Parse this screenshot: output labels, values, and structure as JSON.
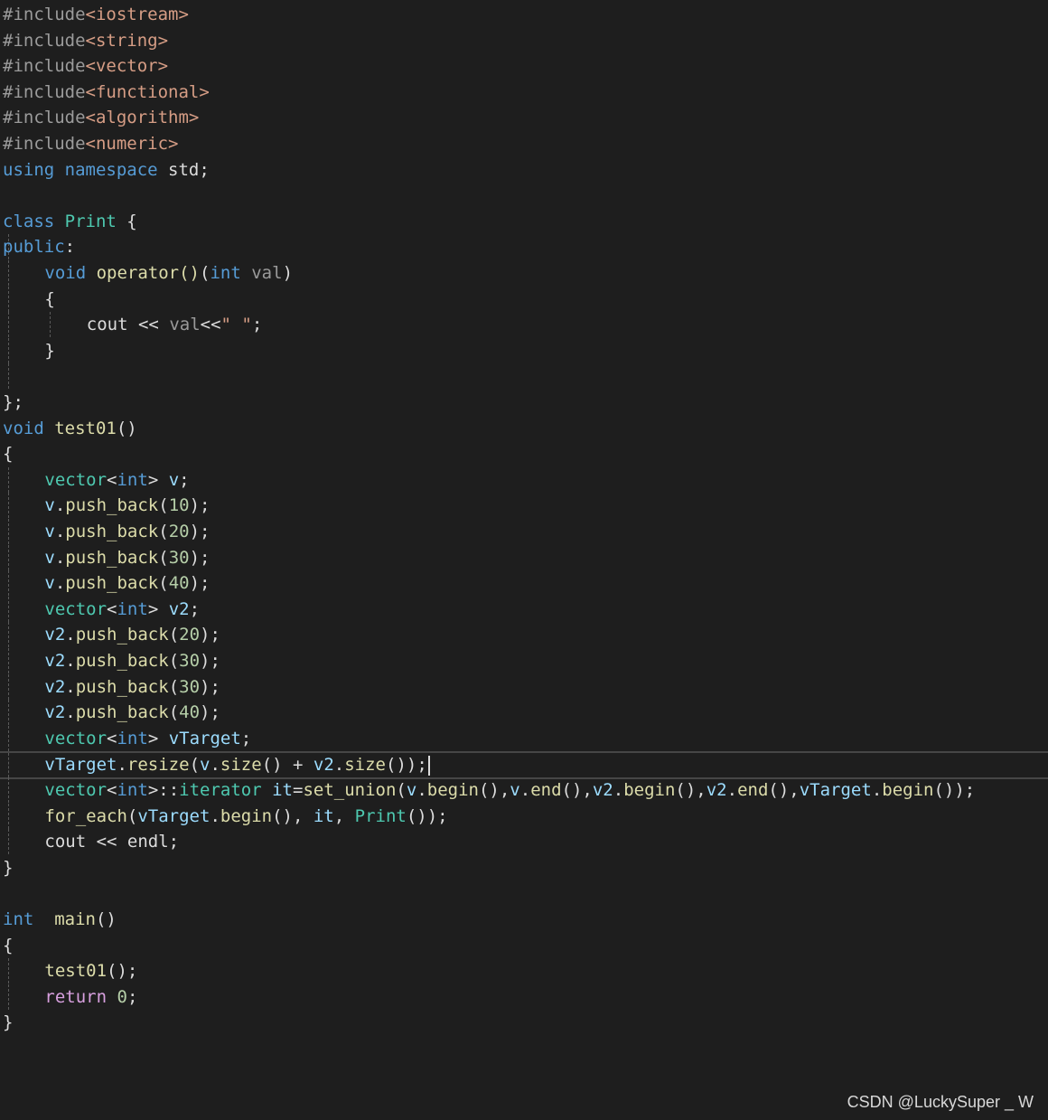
{
  "editor": {
    "lines": [
      {
        "tokens": [
          {
            "c": "pre",
            "t": "#include"
          },
          {
            "c": "inc",
            "t": "<iostream>"
          }
        ]
      },
      {
        "tokens": [
          {
            "c": "pre",
            "t": "#include"
          },
          {
            "c": "inc",
            "t": "<string>"
          }
        ]
      },
      {
        "tokens": [
          {
            "c": "pre",
            "t": "#include"
          },
          {
            "c": "inc",
            "t": "<vector>"
          }
        ]
      },
      {
        "tokens": [
          {
            "c": "pre",
            "t": "#include"
          },
          {
            "c": "inc",
            "t": "<functional>"
          }
        ]
      },
      {
        "tokens": [
          {
            "c": "pre",
            "t": "#include"
          },
          {
            "c": "inc",
            "t": "<algorithm>"
          }
        ]
      },
      {
        "tokens": [
          {
            "c": "pre",
            "t": "#include"
          },
          {
            "c": "inc",
            "t": "<numeric>"
          }
        ]
      },
      {
        "tokens": [
          {
            "c": "kw",
            "t": "using"
          },
          {
            "c": "pl",
            "t": " "
          },
          {
            "c": "kw",
            "t": "namespace"
          },
          {
            "c": "pl",
            "t": " std;"
          }
        ]
      },
      {
        "tokens": []
      },
      {
        "tokens": [
          {
            "c": "kw",
            "t": "class"
          },
          {
            "c": "pl",
            "t": " "
          },
          {
            "c": "ty",
            "t": "Print"
          },
          {
            "c": "pl",
            "t": " {"
          }
        ]
      },
      {
        "tokens": [
          {
            "c": "kw",
            "t": "public"
          },
          {
            "c": "pl",
            "t": ":"
          }
        ],
        "guides": [
          0
        ]
      },
      {
        "tokens": [
          {
            "c": "kw",
            "t": "void"
          },
          {
            "c": "pl",
            "t": " "
          },
          {
            "c": "fn",
            "t": "operator()"
          },
          {
            "c": "pl",
            "t": "("
          },
          {
            "c": "kw",
            "t": "int"
          },
          {
            "c": "pl",
            "t": " "
          },
          {
            "c": "par",
            "t": "val"
          },
          {
            "c": "pl",
            "t": ")"
          }
        ],
        "indent": 4,
        "guides": [
          0
        ]
      },
      {
        "tokens": [
          {
            "c": "pl",
            "t": "{"
          }
        ],
        "indent": 4,
        "guides": [
          0
        ]
      },
      {
        "tokens": [
          {
            "c": "pl",
            "t": "cout << "
          },
          {
            "c": "par",
            "t": "val"
          },
          {
            "c": "pl",
            "t": "<<"
          },
          {
            "c": "str",
            "t": "\" \""
          },
          {
            "c": "pl",
            "t": ";"
          }
        ],
        "indent": 8,
        "guides": [
          0,
          4
        ]
      },
      {
        "tokens": [
          {
            "c": "pl",
            "t": "}"
          }
        ],
        "indent": 4,
        "guides": [
          0
        ]
      },
      {
        "tokens": [],
        "guides": [
          0
        ]
      },
      {
        "tokens": [
          {
            "c": "pl",
            "t": "};"
          }
        ]
      },
      {
        "tokens": [
          {
            "c": "kw",
            "t": "void"
          },
          {
            "c": "pl",
            "t": " "
          },
          {
            "c": "fn",
            "t": "test01"
          },
          {
            "c": "pl",
            "t": "()"
          }
        ]
      },
      {
        "tokens": [
          {
            "c": "pl",
            "t": "{"
          }
        ]
      },
      {
        "tokens": [
          {
            "c": "ty",
            "t": "vector"
          },
          {
            "c": "pl",
            "t": "<"
          },
          {
            "c": "kw",
            "t": "int"
          },
          {
            "c": "pl",
            "t": "> "
          },
          {
            "c": "var",
            "t": "v"
          },
          {
            "c": "pl",
            "t": ";"
          }
        ],
        "indent": 4,
        "guides": [
          0
        ]
      },
      {
        "tokens": [
          {
            "c": "var",
            "t": "v"
          },
          {
            "c": "pl",
            "t": "."
          },
          {
            "c": "fn",
            "t": "push_back"
          },
          {
            "c": "pl",
            "t": "("
          },
          {
            "c": "num",
            "t": "10"
          },
          {
            "c": "pl",
            "t": ");"
          }
        ],
        "indent": 4,
        "guides": [
          0
        ]
      },
      {
        "tokens": [
          {
            "c": "var",
            "t": "v"
          },
          {
            "c": "pl",
            "t": "."
          },
          {
            "c": "fn",
            "t": "push_back"
          },
          {
            "c": "pl",
            "t": "("
          },
          {
            "c": "num",
            "t": "20"
          },
          {
            "c": "pl",
            "t": ");"
          }
        ],
        "indent": 4,
        "guides": [
          0
        ]
      },
      {
        "tokens": [
          {
            "c": "var",
            "t": "v"
          },
          {
            "c": "pl",
            "t": "."
          },
          {
            "c": "fn",
            "t": "push_back"
          },
          {
            "c": "pl",
            "t": "("
          },
          {
            "c": "num",
            "t": "30"
          },
          {
            "c": "pl",
            "t": ");"
          }
        ],
        "indent": 4,
        "guides": [
          0
        ]
      },
      {
        "tokens": [
          {
            "c": "var",
            "t": "v"
          },
          {
            "c": "pl",
            "t": "."
          },
          {
            "c": "fn",
            "t": "push_back"
          },
          {
            "c": "pl",
            "t": "("
          },
          {
            "c": "num",
            "t": "40"
          },
          {
            "c": "pl",
            "t": ");"
          }
        ],
        "indent": 4,
        "guides": [
          0
        ]
      },
      {
        "tokens": [
          {
            "c": "ty",
            "t": "vector"
          },
          {
            "c": "pl",
            "t": "<"
          },
          {
            "c": "kw",
            "t": "int"
          },
          {
            "c": "pl",
            "t": "> "
          },
          {
            "c": "var",
            "t": "v2"
          },
          {
            "c": "pl",
            "t": ";"
          }
        ],
        "indent": 4,
        "guides": [
          0
        ]
      },
      {
        "tokens": [
          {
            "c": "var",
            "t": "v2"
          },
          {
            "c": "pl",
            "t": "."
          },
          {
            "c": "fn",
            "t": "push_back"
          },
          {
            "c": "pl",
            "t": "("
          },
          {
            "c": "num",
            "t": "20"
          },
          {
            "c": "pl",
            "t": ");"
          }
        ],
        "indent": 4,
        "guides": [
          0
        ]
      },
      {
        "tokens": [
          {
            "c": "var",
            "t": "v2"
          },
          {
            "c": "pl",
            "t": "."
          },
          {
            "c": "fn",
            "t": "push_back"
          },
          {
            "c": "pl",
            "t": "("
          },
          {
            "c": "num",
            "t": "30"
          },
          {
            "c": "pl",
            "t": ");"
          }
        ],
        "indent": 4,
        "guides": [
          0
        ]
      },
      {
        "tokens": [
          {
            "c": "var",
            "t": "v2"
          },
          {
            "c": "pl",
            "t": "."
          },
          {
            "c": "fn",
            "t": "push_back"
          },
          {
            "c": "pl",
            "t": "("
          },
          {
            "c": "num",
            "t": "30"
          },
          {
            "c": "pl",
            "t": ");"
          }
        ],
        "indent": 4,
        "guides": [
          0
        ]
      },
      {
        "tokens": [
          {
            "c": "var",
            "t": "v2"
          },
          {
            "c": "pl",
            "t": "."
          },
          {
            "c": "fn",
            "t": "push_back"
          },
          {
            "c": "pl",
            "t": "("
          },
          {
            "c": "num",
            "t": "40"
          },
          {
            "c": "pl",
            "t": ");"
          }
        ],
        "indent": 4,
        "guides": [
          0
        ]
      },
      {
        "tokens": [
          {
            "c": "ty",
            "t": "vector"
          },
          {
            "c": "pl",
            "t": "<"
          },
          {
            "c": "kw",
            "t": "int"
          },
          {
            "c": "pl",
            "t": "> "
          },
          {
            "c": "var",
            "t": "vTarget"
          },
          {
            "c": "pl",
            "t": ";"
          }
        ],
        "indent": 4,
        "guides": [
          0
        ]
      },
      {
        "tokens": [
          {
            "c": "var",
            "t": "vTarget"
          },
          {
            "c": "pl",
            "t": "."
          },
          {
            "c": "fn",
            "t": "resize"
          },
          {
            "c": "pl",
            "t": "("
          },
          {
            "c": "var",
            "t": "v"
          },
          {
            "c": "pl",
            "t": "."
          },
          {
            "c": "fn",
            "t": "size"
          },
          {
            "c": "pl",
            "t": "() + "
          },
          {
            "c": "var",
            "t": "v2"
          },
          {
            "c": "pl",
            "t": "."
          },
          {
            "c": "fn",
            "t": "size"
          },
          {
            "c": "pl",
            "t": "());"
          }
        ],
        "indent": 4,
        "guides": [
          0
        ],
        "current": true
      },
      {
        "tokens": [
          {
            "c": "ty",
            "t": "vector"
          },
          {
            "c": "pl",
            "t": "<"
          },
          {
            "c": "kw",
            "t": "int"
          },
          {
            "c": "pl",
            "t": ">::"
          },
          {
            "c": "ty",
            "t": "iterator"
          },
          {
            "c": "pl",
            "t": " "
          },
          {
            "c": "var",
            "t": "it"
          },
          {
            "c": "pl",
            "t": "="
          },
          {
            "c": "fn",
            "t": "set_union"
          },
          {
            "c": "pl",
            "t": "("
          },
          {
            "c": "var",
            "t": "v"
          },
          {
            "c": "pl",
            "t": "."
          },
          {
            "c": "fn",
            "t": "begin"
          },
          {
            "c": "pl",
            "t": "(),"
          },
          {
            "c": "var",
            "t": "v"
          },
          {
            "c": "pl",
            "t": "."
          },
          {
            "c": "fn",
            "t": "end"
          },
          {
            "c": "pl",
            "t": "(),"
          },
          {
            "c": "var",
            "t": "v2"
          },
          {
            "c": "pl",
            "t": "."
          },
          {
            "c": "fn",
            "t": "begin"
          },
          {
            "c": "pl",
            "t": "(),"
          },
          {
            "c": "var",
            "t": "v2"
          },
          {
            "c": "pl",
            "t": "."
          },
          {
            "c": "fn",
            "t": "end"
          },
          {
            "c": "pl",
            "t": "(),"
          },
          {
            "c": "var",
            "t": "vTarget"
          },
          {
            "c": "pl",
            "t": "."
          },
          {
            "c": "fn",
            "t": "begin"
          },
          {
            "c": "pl",
            "t": "());"
          }
        ],
        "indent": 4,
        "guides": [
          0
        ]
      },
      {
        "tokens": [
          {
            "c": "fn",
            "t": "for_each"
          },
          {
            "c": "pl",
            "t": "("
          },
          {
            "c": "var",
            "t": "vTarget"
          },
          {
            "c": "pl",
            "t": "."
          },
          {
            "c": "fn",
            "t": "begin"
          },
          {
            "c": "pl",
            "t": "(), "
          },
          {
            "c": "var",
            "t": "it"
          },
          {
            "c": "pl",
            "t": ", "
          },
          {
            "c": "ty",
            "t": "Print"
          },
          {
            "c": "pl",
            "t": "());"
          }
        ],
        "indent": 4,
        "guides": [
          0
        ]
      },
      {
        "tokens": [
          {
            "c": "pl",
            "t": "cout << endl;"
          }
        ],
        "indent": 4,
        "guides": [
          0
        ]
      },
      {
        "tokens": [
          {
            "c": "pl",
            "t": "}"
          }
        ]
      },
      {
        "tokens": []
      },
      {
        "tokens": [
          {
            "c": "kw",
            "t": "int"
          },
          {
            "c": "pl",
            "t": "  "
          },
          {
            "c": "fn",
            "t": "main"
          },
          {
            "c": "pl",
            "t": "()"
          }
        ]
      },
      {
        "tokens": [
          {
            "c": "pl",
            "t": "{"
          }
        ]
      },
      {
        "tokens": [
          {
            "c": "fn",
            "t": "test01"
          },
          {
            "c": "pl",
            "t": "();"
          }
        ],
        "indent": 4,
        "guides": [
          0
        ]
      },
      {
        "tokens": [
          {
            "c": "ctl",
            "t": "return"
          },
          {
            "c": "pl",
            "t": " "
          },
          {
            "c": "num",
            "t": "0"
          },
          {
            "c": "pl",
            "t": ";"
          }
        ],
        "indent": 4,
        "guides": [
          0
        ]
      },
      {
        "tokens": [
          {
            "c": "pl",
            "t": "}"
          }
        ]
      }
    ]
  },
  "watermark": {
    "text": "CSDN @LuckySuper _ W"
  }
}
